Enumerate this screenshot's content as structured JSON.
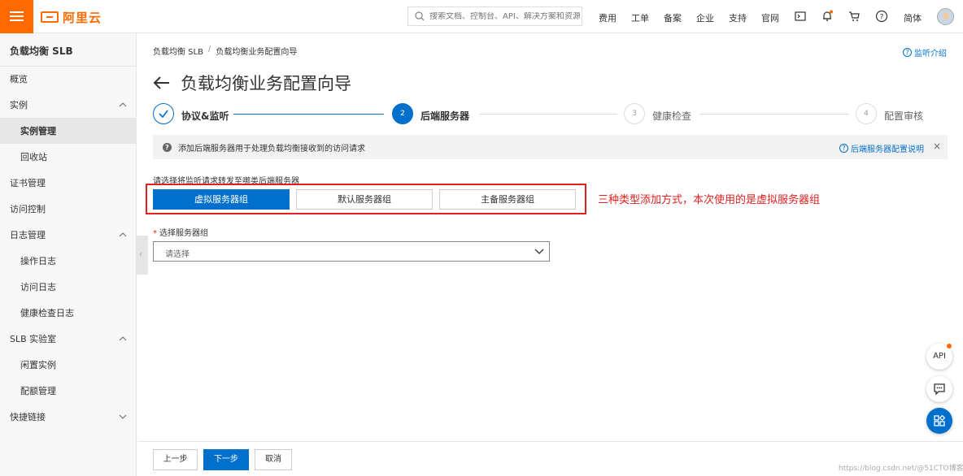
{
  "topbar": {
    "logo_text": "阿里云",
    "search_placeholder": "搜索文档、控制台、API、解决方案和资源",
    "nav": [
      "费用",
      "工单",
      "备案",
      "企业",
      "支持",
      "官网"
    ],
    "lang": "简体",
    "icons": [
      "terminal-icon",
      "bell-icon",
      "cart-icon",
      "help-icon"
    ],
    "accent": "#ff6a00"
  },
  "sidebar": {
    "title": "负载均衡 SLB",
    "items": [
      {
        "label": "概览"
      },
      {
        "label": "实例"
      },
      {
        "label": "实例管理"
      },
      {
        "label": "回收站"
      },
      {
        "label": "证书管理"
      },
      {
        "label": "访问控制"
      },
      {
        "label": "日志管理"
      },
      {
        "label": "操作日志"
      },
      {
        "label": "访问日志"
      },
      {
        "label": "健康检查日志"
      },
      {
        "label": "SLB 实验室"
      },
      {
        "label": "闲置实例"
      },
      {
        "label": "配额管理"
      },
      {
        "label": "快捷链接"
      }
    ]
  },
  "main": {
    "breadcrumb": [
      "负载均衡 SLB",
      "负载均衡业务配置向导"
    ],
    "help_link": "监听介绍",
    "title": "负载均衡业务配置向导",
    "steps": [
      {
        "label": "协议&监听",
        "state": "done"
      },
      {
        "label": "后端服务器",
        "num": "2",
        "state": "current"
      },
      {
        "label": "健康检查",
        "num": "3",
        "state": "todo"
      },
      {
        "label": "配置审核",
        "num": "4",
        "state": "todo"
      }
    ],
    "info_text": "添加后端服务器用于处理负载均衡接收到的访问请求",
    "info_link": "后端服务器配置说明",
    "prompt": "请选择将监听请求转发至哪类后端服务器",
    "server_types": [
      "虚拟服务器组",
      "默认服务器组",
      "主备服务器组"
    ],
    "selected_type": "虚拟服务器组",
    "annotation": "三种类型添加方式，本次使用的是虚拟服务器组",
    "field_label": "选择服务器组",
    "select_placeholder": "请选择"
  },
  "floating": {
    "api_label": "API"
  },
  "footer": {
    "prev": "上一步",
    "next": "下一步",
    "cancel": "取消"
  },
  "watermark": "https://blog.csdn.net/@51CTO博客",
  "colors": {
    "primary": "#0070cc",
    "annotation": "#e02020"
  }
}
